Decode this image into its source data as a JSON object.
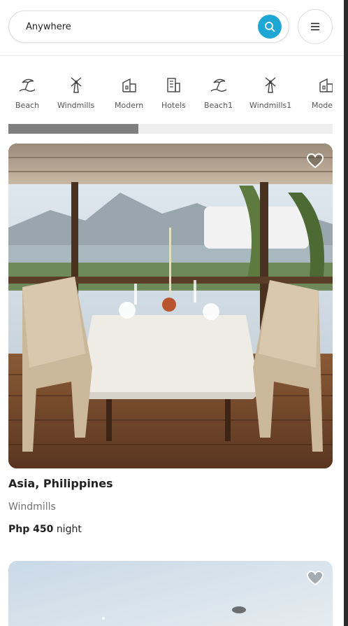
{
  "search": {
    "location": "Anywhere"
  },
  "categories": [
    {
      "label": "Beach",
      "icon": "beach-icon"
    },
    {
      "label": "Windmills",
      "icon": "windmill-icon"
    },
    {
      "label": "Modern",
      "icon": "modern-house-icon"
    },
    {
      "label": "Hotels",
      "icon": "hotel-icon"
    },
    {
      "label": "Beach1",
      "icon": "beach-icon"
    },
    {
      "label": "Windmills1",
      "icon": "windmill-icon"
    },
    {
      "label": "Modern",
      "icon": "modern-house-icon"
    }
  ],
  "scroll_progress": 0.4,
  "listings": [
    {
      "location": "Asia, Philippines",
      "category": "Windmills",
      "price": "Php 450",
      "price_unit": "night"
    },
    {}
  ],
  "colors": {
    "accent": "#1ea7d4"
  }
}
